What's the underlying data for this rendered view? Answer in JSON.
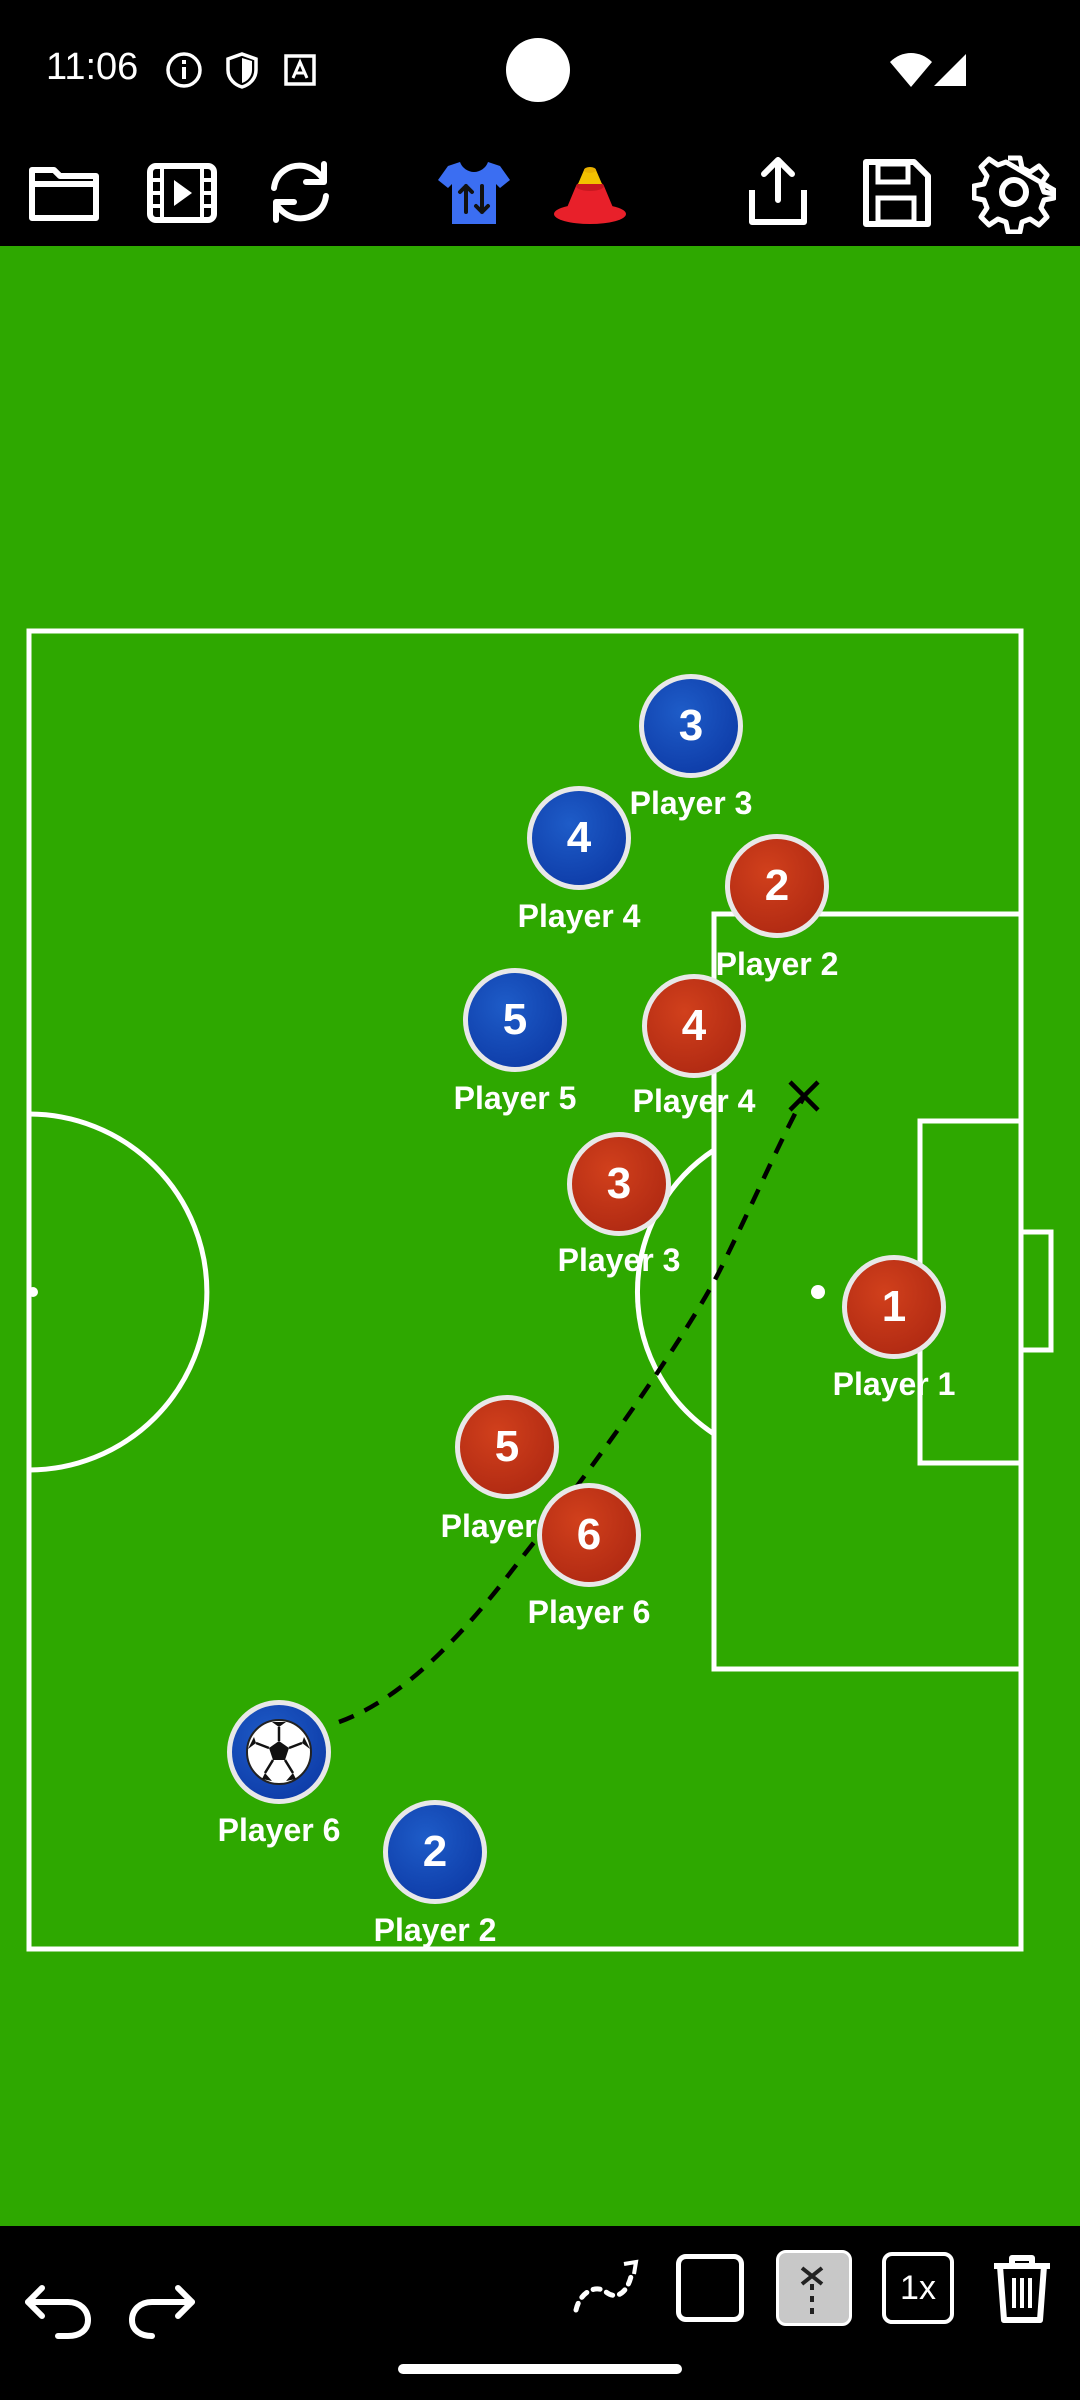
{
  "status_bar": {
    "time": "11:06",
    "icons": [
      "info-icon",
      "shield-icon",
      "text-icon",
      "wifi-icon",
      "signal-icon"
    ]
  },
  "toolbar": {
    "buttons": [
      "folder-icon",
      "video-icon",
      "rotate-icon",
      "jersey-swap-icon",
      "cones-icon",
      "share-icon",
      "save-icon",
      "settings-icon"
    ],
    "colors": {
      "jersey": "#3b6ef2",
      "cone_top": "#f2c200",
      "cone_bottom": "#e8202a"
    }
  },
  "field": {
    "colors": {
      "grass": "#2ea800",
      "lines": "#ffffff",
      "blue_team": "#0a3ea8",
      "red_team": "#b82c14"
    },
    "blue_players": [
      {
        "number": "3",
        "label": "Player 3"
      },
      {
        "number": "4",
        "label": "Player 4"
      },
      {
        "number": "5",
        "label": "Player 5"
      },
      {
        "number": "2",
        "label": "Player 2"
      }
    ],
    "red_players": [
      {
        "number": "2",
        "label": "Player 2"
      },
      {
        "number": "4",
        "label": "Player 4"
      },
      {
        "number": "3",
        "label": "Player 3"
      },
      {
        "number": "1",
        "label": "Player 1"
      },
      {
        "number": "5",
        "label": "Player 5"
      },
      {
        "number": "6",
        "label": "Player 6"
      }
    ],
    "ball_player": {
      "label": "Player 6",
      "icon": "soccer-ball-icon"
    }
  },
  "bottom_bar": {
    "left_buttons": [
      "undo-icon",
      "redo-icon"
    ],
    "right_buttons": [
      "dotted-path-icon",
      "square-icon",
      "run-path-icon",
      "speed-button",
      "trash-icon"
    ],
    "speed_label": "1x"
  }
}
